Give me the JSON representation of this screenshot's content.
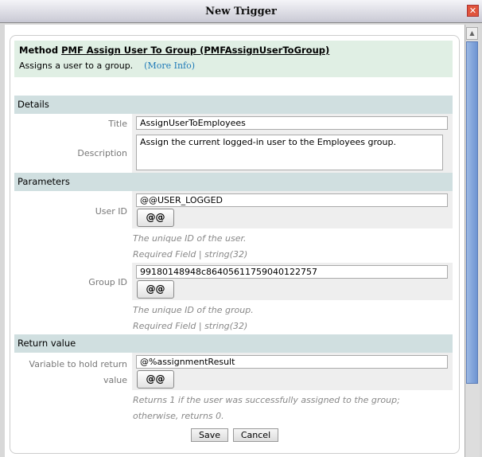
{
  "window": {
    "title": "New Trigger"
  },
  "method": {
    "prefix": "Method",
    "name": "PMF Assign User To Group (PMFAssignUserToGroup)",
    "description": "Assigns a user to a group.",
    "more_info": "(More Info)"
  },
  "details": {
    "heading": "Details",
    "title_label": "Title",
    "title_value": "AssignUserToEmployees",
    "description_label": "Description",
    "description_value": "Assign the current logged-in user to the Employees group."
  },
  "parameters": {
    "heading": "Parameters",
    "user_id": {
      "label": "User ID",
      "value": "@@USER_LOGGED",
      "button": "@@",
      "hint": "The unique ID of the user.",
      "required": "Required Field | string(32)"
    },
    "group_id": {
      "label": "Group ID",
      "value": "99180148948c86405611759040122757",
      "button": "@@",
      "hint": "The unique ID of the group.",
      "required": "Required Field | string(32)"
    }
  },
  "return_value": {
    "heading": "Return value",
    "label_line1": "Variable to hold return",
    "label_line2": "value",
    "value": "@%assignmentResult",
    "button": "@@",
    "hint_line1": "Returns 1 if the user was successfully assigned to the group;",
    "hint_line2": "otherwise, returns 0."
  },
  "actions": {
    "save": "Save",
    "cancel": "Cancel"
  }
}
